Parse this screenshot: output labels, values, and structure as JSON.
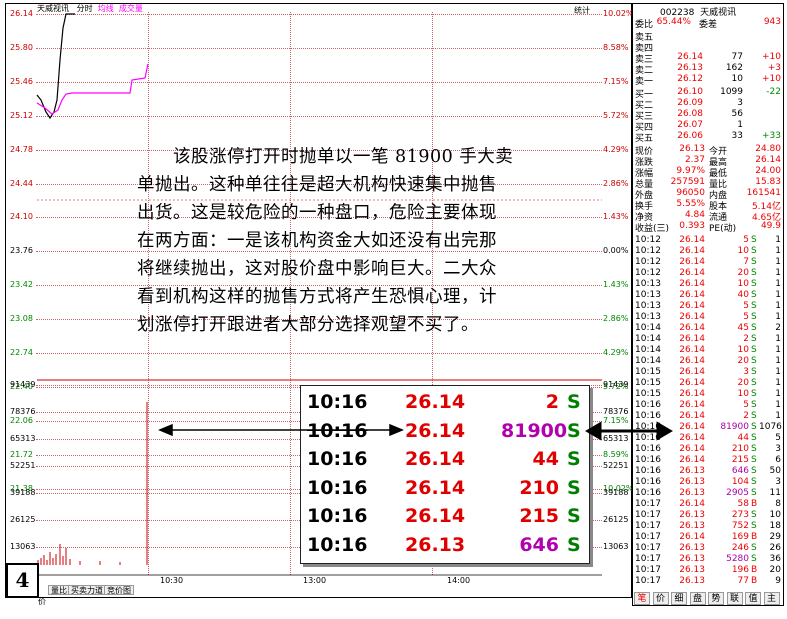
{
  "chart_header": {
    "stock_name": "天威视讯",
    "mode": "分时",
    "series_avg": "均线",
    "series_vol": "成交量",
    "corner": "统计"
  },
  "y_left": [
    "26.14",
    "25.80",
    "25.46",
    "25.12",
    "24.78",
    "24.44",
    "24.10",
    "23.76",
    "23.42",
    "23.08",
    "22.74",
    "22.40",
    "22.06",
    "21.72",
    "21.38"
  ],
  "y_right": [
    "10.02%",
    "8.58%",
    "7.15%",
    "5.72%",
    "4.29%",
    "2.86%",
    "1.43%",
    "0.00%",
    "1.43%",
    "2.86%",
    "4.29%",
    "5.72%",
    "7.15%",
    "8.59%",
    "10.02%"
  ],
  "vol_left": [
    "91439",
    "78376",
    "65313",
    "52251",
    "39188",
    "26125",
    "13063"
  ],
  "vol_right": [
    "91439",
    "78376",
    "65313",
    "52251",
    "39188",
    "26125",
    "13063"
  ],
  "x_times": [
    "10:30",
    "13:00",
    "14:00"
  ],
  "bottom_tabs": [
    "量比",
    "买卖力道",
    "竞价图"
  ],
  "bottom_label": "价",
  "colors": {
    "up": "#e00000",
    "down": "#008000",
    "price_line": "#000000",
    "avg_line": "#ff00ff"
  },
  "right_panel": {
    "code": "002238",
    "name": "天威视讯",
    "weibi_label": "委比",
    "weibi": "65.44%",
    "weicha_label": "委差",
    "weicha": "943",
    "asks": [
      {
        "label": "卖五",
        "price": "",
        "qty": "",
        "chg": ""
      },
      {
        "label": "卖四",
        "price": "",
        "qty": "",
        "chg": ""
      },
      {
        "label": "卖三",
        "price": "26.14",
        "qty": "77",
        "chg": "+10"
      },
      {
        "label": "卖二",
        "price": "26.13",
        "qty": "162",
        "chg": "+3"
      },
      {
        "label": "卖一",
        "price": "26.12",
        "qty": "10",
        "chg": "+10"
      }
    ],
    "bids": [
      {
        "label": "买一",
        "price": "26.10",
        "qty": "1099",
        "chg": "-22"
      },
      {
        "label": "买二",
        "price": "26.09",
        "qty": "3",
        "chg": ""
      },
      {
        "label": "买三",
        "price": "26.08",
        "qty": "56",
        "chg": ""
      },
      {
        "label": "买四",
        "price": "26.07",
        "qty": "1",
        "chg": ""
      },
      {
        "label": "买五",
        "price": "26.06",
        "qty": "33",
        "chg": "+33"
      }
    ],
    "stats": [
      {
        "l1": "现价",
        "v1": "26.13",
        "l2": "今开",
        "v2": "24.80"
      },
      {
        "l1": "涨跌",
        "v1": "2.37",
        "l2": "最高",
        "v2": "26.14"
      },
      {
        "l1": "涨幅",
        "v1": "9.97%",
        "l2": "最低",
        "v2": "24.00"
      },
      {
        "l1": "总量",
        "v1": "257591",
        "l2": "量比",
        "v2": "15.83"
      },
      {
        "l1": "外盘",
        "v1": "96050",
        "l2": "内盘",
        "v2": "161541"
      },
      {
        "l1": "换手",
        "v1": "5.55%",
        "l2": "股本",
        "v2": "5.14亿"
      },
      {
        "l1": "净资",
        "v1": "4.84",
        "l2": "流通",
        "v2": "4.65亿"
      },
      {
        "l1": "收益(三)",
        "v1": "0.393",
        "l2": "PE(动)",
        "v2": "49.9"
      }
    ],
    "ticks": [
      [
        "10:12",
        "26.14",
        "5",
        "S",
        "1"
      ],
      [
        "10:12",
        "26.14",
        "10",
        "S",
        "1"
      ],
      [
        "10:12",
        "26.14",
        "7",
        "S",
        "1"
      ],
      [
        "10:12",
        "26.14",
        "20",
        "S",
        "1"
      ],
      [
        "10:13",
        "26.14",
        "10",
        "S",
        "1"
      ],
      [
        "10:13",
        "26.14",
        "40",
        "S",
        "1"
      ],
      [
        "10:13",
        "26.14",
        "5",
        "S",
        "1"
      ],
      [
        "10:13",
        "26.14",
        "5",
        "S",
        "1"
      ],
      [
        "10:14",
        "26.14",
        "45",
        "S",
        "2"
      ],
      [
        "10:14",
        "26.14",
        "2",
        "S",
        "1"
      ],
      [
        "10:14",
        "26.14",
        "10",
        "S",
        "1"
      ],
      [
        "10:14",
        "26.14",
        "20",
        "S",
        "1"
      ],
      [
        "10:15",
        "26.14",
        "3",
        "S",
        "1"
      ],
      [
        "10:15",
        "26.14",
        "20",
        "S",
        "1"
      ],
      [
        "10:15",
        "26.14",
        "10",
        "S",
        "1"
      ],
      [
        "10:16",
        "26.14",
        "5",
        "S",
        "1"
      ],
      [
        "10:16",
        "26.14",
        "2",
        "S",
        "1"
      ],
      [
        "10:16",
        "26.14",
        "81900",
        "S",
        "1076"
      ],
      [
        "10:16",
        "26.14",
        "44",
        "S",
        "5"
      ],
      [
        "10:16",
        "26.14",
        "210",
        "S",
        "3"
      ],
      [
        "10:16",
        "26.14",
        "215",
        "S",
        "6"
      ],
      [
        "10:16",
        "26.13",
        "646",
        "S",
        "50"
      ],
      [
        "10:16",
        "26.13",
        "104",
        "S",
        "3"
      ],
      [
        "10:16",
        "26.13",
        "2905",
        "S",
        "11"
      ],
      [
        "10:17",
        "26.14",
        "58",
        "B",
        "8"
      ],
      [
        "10:17",
        "26.13",
        "273",
        "S",
        "10"
      ],
      [
        "10:17",
        "26.13",
        "752",
        "S",
        "18"
      ],
      [
        "10:17",
        "26.14",
        "169",
        "B",
        "29"
      ],
      [
        "10:17",
        "26.13",
        "246",
        "S",
        "26"
      ],
      [
        "10:17",
        "26.13",
        "5280",
        "S",
        "36"
      ],
      [
        "10:17",
        "26.13",
        "196",
        "B",
        "20"
      ],
      [
        "10:17",
        "26.13",
        "77",
        "B",
        "9"
      ]
    ],
    "bottom_tabs": [
      "笔",
      "价",
      "细",
      "盘",
      "势",
      "联",
      "值",
      "主"
    ]
  },
  "annotation": {
    "lines": [
      "　　该股涨停打开时抛单以一笔 81900 手大卖",
      "单抛出。这种单往往是超大机构快速集中抛售",
      "出货。这是较危险的一种盘口，危险主要体现",
      "在两方面：一是该机构资金大如还没有出完那",
      "将继续抛出，这对股价盘中影响巨大。二大众",
      "看到机构这样的抛售方式将产生恐惧心理，计",
      "划涨停打开跟进者大部分选择观望不买了。"
    ]
  },
  "zoom": [
    {
      "time": "10:16",
      "price": "26.14",
      "qty": "2",
      "side": "S",
      "qty_color": "#e00000",
      "strike": false
    },
    {
      "time": "10:16",
      "price": "26.14",
      "qty": "81900",
      "side": "S",
      "qty_color": "#b000b0",
      "strike": true
    },
    {
      "time": "10:16",
      "price": "26.14",
      "qty": "44",
      "side": "S",
      "qty_color": "#e00000",
      "strike": false
    },
    {
      "time": "10:16",
      "price": "26.14",
      "qty": "210",
      "side": "S",
      "qty_color": "#e00000",
      "strike": false
    },
    {
      "time": "10:16",
      "price": "26.14",
      "qty": "215",
      "side": "S",
      "qty_color": "#e00000",
      "strike": false
    },
    {
      "time": "10:16",
      "price": "26.13",
      "qty": "646",
      "side": "S",
      "qty_color": "#b000b0",
      "strike": false
    }
  ],
  "figure_number": "4"
}
